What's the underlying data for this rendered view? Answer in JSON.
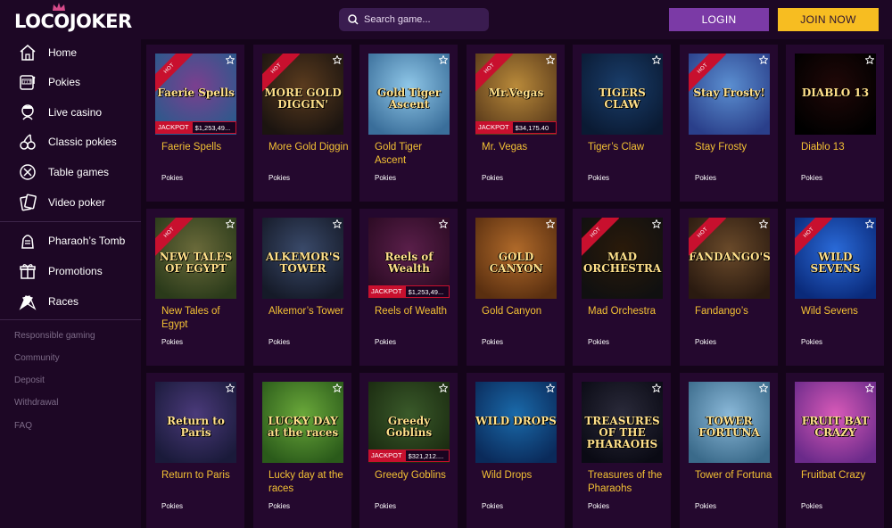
{
  "header": {
    "logo": "LOCOJOKER",
    "search_placeholder": "Search game...",
    "login_label": "LOGIN",
    "join_label": "JOIN NOW"
  },
  "sidebar": {
    "items": [
      {
        "label": "Home",
        "icon": "home-icon"
      },
      {
        "label": "Pokies",
        "icon": "slot-machine-icon"
      },
      {
        "label": "Live casino",
        "icon": "dealer-icon"
      },
      {
        "label": "Classic pokies",
        "icon": "cherries-icon"
      },
      {
        "label": "Table games",
        "icon": "roulette-icon"
      },
      {
        "label": "Video poker",
        "icon": "cards-icon"
      }
    ],
    "extra_items": [
      {
        "label": "Pharaoh’s Tomb",
        "icon": "pharaoh-icon"
      },
      {
        "label": "Promotions",
        "icon": "gift-icon"
      },
      {
        "label": "Races",
        "icon": "race-flags-icon"
      }
    ],
    "links": [
      "Responsible gaming",
      "Community",
      "Deposit",
      "Withdrawal",
      "FAQ"
    ]
  },
  "games": [
    {
      "name": "Faerie Spells",
      "art": "Faerie Spells",
      "category": "Pokies",
      "hot": true,
      "jackpot": "$1,253,49...",
      "bg": "#7b3f8f",
      "bg2": "#2a5a8c"
    },
    {
      "name": "More Gold Diggin",
      "art": "MORE GOLD DIGGIN'",
      "category": "Pokies",
      "hot": true,
      "jackpot": "",
      "bg": "#5a3b1e",
      "bg2": "#1b1410"
    },
    {
      "name": "Gold Tiger Ascent",
      "art": "Gold Tiger Ascent",
      "category": "Pokies",
      "hot": false,
      "jackpot": "",
      "bg": "#8fc7e8",
      "bg2": "#3a6e9a"
    },
    {
      "name": "Mr. Vegas",
      "art": "Mr.Vegas",
      "category": "Pokies",
      "hot": true,
      "jackpot": "$34,175.40",
      "bg": "#b98a3a",
      "bg2": "#5b3b1b"
    },
    {
      "name": "Tiger’s Claw",
      "art": "TIGERS CLAW",
      "category": "Pokies",
      "hot": false,
      "jackpot": "",
      "bg": "#1a3e6b",
      "bg2": "#0a1a33"
    },
    {
      "name": "Stay Frosty",
      "art": "Stay Frosty!",
      "category": "Pokies",
      "hot": true,
      "jackpot": "",
      "bg": "#5b8fd1",
      "bg2": "#2a3f8a"
    },
    {
      "name": "Diablo 13",
      "art": "DIABLO 13",
      "category": "Pokies",
      "hot": false,
      "jackpot": "",
      "bg": "#200808",
      "bg2": "#000000"
    },
    {
      "name": "New Tales of Egypt",
      "art": "NEW TALES OF EGYPT",
      "category": "Pokies",
      "hot": true,
      "jackpot": "",
      "bg": "#6a6a3a",
      "bg2": "#2a3a1a"
    },
    {
      "name": "Alkemor’s Tower",
      "art": "ALKEMOR'S TOWER",
      "category": "Pokies",
      "hot": false,
      "jackpot": "",
      "bg": "#3a4a6a",
      "bg2": "#151a28"
    },
    {
      "name": "Reels of Wealth",
      "art": "Reels of Wealth",
      "category": "Pokies",
      "hot": false,
      "jackpot": "$1,253,49...",
      "bg": "#5a1f4a",
      "bg2": "#2a0a22"
    },
    {
      "name": "Gold Canyon",
      "art": "GOLD CANYON",
      "category": "Pokies",
      "hot": false,
      "jackpot": "",
      "bg": "#b06a2a",
      "bg2": "#5a2f10"
    },
    {
      "name": "Mad Orchestra",
      "art": "MAD ORCHESTRA",
      "category": "Pokies",
      "hot": true,
      "jackpot": "",
      "bg": "#2a1a0a",
      "bg2": "#101010"
    },
    {
      "name": "Fandango’s",
      "art": "FANDANGO'S",
      "category": "Pokies",
      "hot": true,
      "jackpot": "",
      "bg": "#6a4a2a",
      "bg2": "#2a1a10"
    },
    {
      "name": "Wild Sevens",
      "art": "WILD SEVENS",
      "category": "Pokies",
      "hot": true,
      "jackpot": "",
      "bg": "#2a6ad8",
      "bg2": "#0a2a7a"
    },
    {
      "name": "Return to Paris",
      "art": "Return to Paris",
      "category": "Pokies",
      "hot": false,
      "jackpot": "",
      "bg": "#4a3a7a",
      "bg2": "#1a1a3a"
    },
    {
      "name": "Lucky day at the races",
      "art": "LUCKY DAY at the races",
      "category": "Pokies",
      "hot": false,
      "jackpot": "",
      "bg": "#6aa83a",
      "bg2": "#2a5a1a"
    },
    {
      "name": "Greedy Goblins",
      "art": "Greedy Goblins",
      "category": "Pokies",
      "hot": false,
      "jackpot": "$321,212....",
      "bg": "#3a5a2a",
      "bg2": "#1a2a10"
    },
    {
      "name": "Wild Drops",
      "art": "WILD DROPS",
      "category": "Pokies",
      "hot": false,
      "jackpot": "",
      "bg": "#1a6aaa",
      "bg2": "#0a2a5a"
    },
    {
      "name": "Treasures of the Pharaohs",
      "art": "TREASURES OF THE PHARAOHS",
      "category": "Pokies",
      "hot": false,
      "jackpot": "",
      "bg": "#2a2a3a",
      "bg2": "#0a0a14"
    },
    {
      "name": "Tower of Fortuna",
      "art": "TOWER FORTUNA",
      "category": "Pokies",
      "hot": false,
      "jackpot": "",
      "bg": "#8ab8d8",
      "bg2": "#3a6a8a"
    },
    {
      "name": "Fruitbat Crazy",
      "art": "FRUIT BAT CRAZY",
      "category": "Pokies",
      "hot": false,
      "jackpot": "",
      "bg": "#d85ab8",
      "bg2": "#6a2a8a"
    }
  ],
  "labels": {
    "hot": "HOT",
    "jackpot": "JACKPOT"
  }
}
